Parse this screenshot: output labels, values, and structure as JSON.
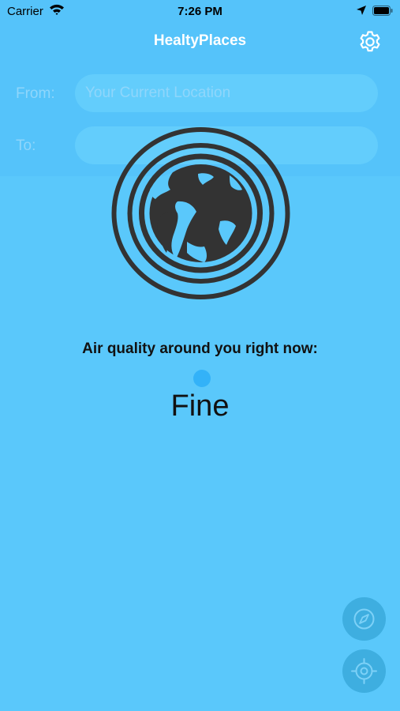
{
  "status_bar": {
    "carrier": "Carrier",
    "time": "7:26 PM",
    "icons": [
      "wifi-icon",
      "location-arrow-icon",
      "battery-icon"
    ]
  },
  "nav": {
    "title": "HealtyPlaces",
    "settings_icon": "gear-icon"
  },
  "route": {
    "from_label": "From:",
    "from_placeholder": "Your Current Location",
    "to_label": "To:",
    "to_placeholder": ""
  },
  "air_quality": {
    "label": "Air quality around you right now:",
    "value": "Fine",
    "indicator_color": "#33b2f8"
  },
  "buttons": {
    "compass_icon": "compass-icon",
    "locate_icon": "crosshair-icon"
  },
  "colors": {
    "background": "#5ac8fb",
    "accent": "#3eaee0",
    "text_white": "#ffffff"
  }
}
